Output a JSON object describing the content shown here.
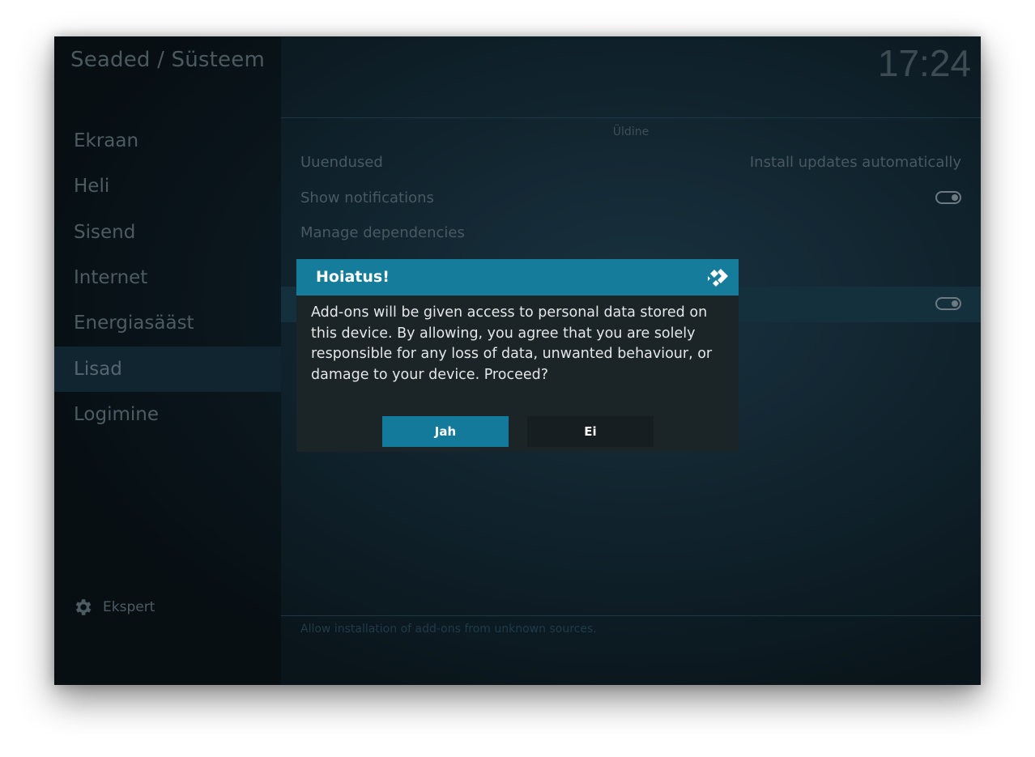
{
  "window": {
    "breadcrumb": "Seaded / Süsteem",
    "clock": "17:24"
  },
  "sidebar": {
    "items": [
      {
        "label": "Ekraan"
      },
      {
        "label": "Heli"
      },
      {
        "label": "Sisend"
      },
      {
        "label": "Internet"
      },
      {
        "label": "Energiasääst"
      },
      {
        "label": "Lisad",
        "active": true
      },
      {
        "label": "Logimine"
      }
    ],
    "expert_label": "Ekspert",
    "expert_icon": "gear-icon"
  },
  "content": {
    "section_title": "Üldine",
    "settings": [
      {
        "label": "Uuendused",
        "value": "Install updates automatically"
      },
      {
        "label": "Show notifications",
        "toggle": true
      },
      {
        "label": "Manage dependencies"
      }
    ],
    "focused_toggle": true,
    "help_text": "Allow installation of add-ons from unknown sources."
  },
  "dialog": {
    "title": "Hoiatus!",
    "logo_icon": "kodi-logo-icon",
    "message": "Add-ons will be given access to personal data stored on this device. By allowing, you agree that you are solely responsible for any loss of data, unwanted behaviour, or damage to your device. Proceed?",
    "yes_label": "Jah",
    "no_label": "Ei"
  },
  "colors": {
    "accent": "#167c9c",
    "dialog_bg": "#1b2426"
  }
}
